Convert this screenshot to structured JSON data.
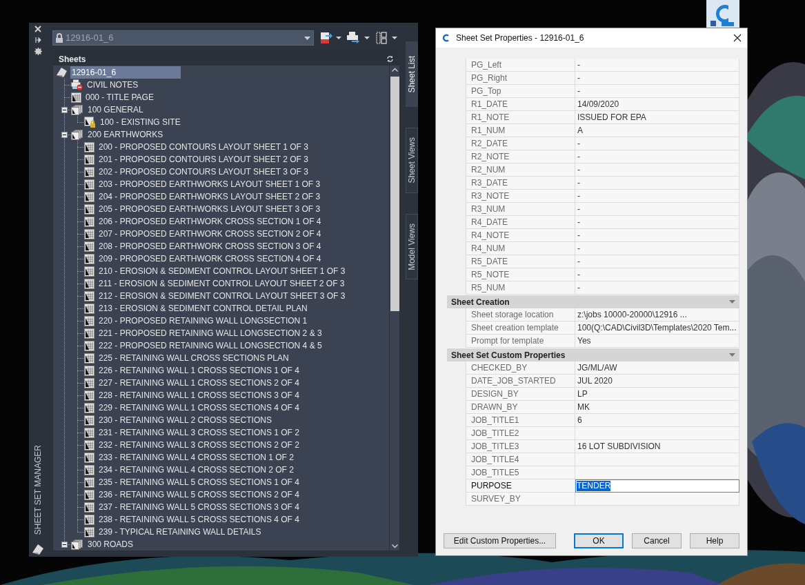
{
  "palette": {
    "title": "SHEET SET MANAGER",
    "sheet_set": "12916-01_6",
    "tabs": [
      {
        "label": "Sheet List",
        "selected": true
      },
      {
        "label": "Sheet Views",
        "selected": false
      },
      {
        "label": "Model Views",
        "selected": false
      }
    ],
    "panel_title": "Sheets",
    "tree": {
      "label": "12916-01_6",
      "kind": "sheetset",
      "selected": true,
      "children": [
        {
          "label": "CIVIL NOTES",
          "kind": "unplottable",
          "selected": false
        },
        {
          "label": "000 - TITLE PAGE",
          "kind": "sheet",
          "selected": false
        },
        {
          "label": "100 GENERAL",
          "kind": "subset",
          "expanded": true,
          "selected": false,
          "children": [
            {
              "label": "100 - EXISTING SITE",
              "kind": "locked",
              "selected": false
            }
          ]
        },
        {
          "label": "200 EARTHWORKS",
          "kind": "subset",
          "expanded": true,
          "selected": false,
          "children": [
            {
              "label": "200 - PROPOSED CONTOURS LAYOUT SHEET 1 OF 3",
              "kind": "sheet",
              "selected": false
            },
            {
              "label": "201 - PROPOSED CONTOURS LAYOUT SHEET 2 OF 3",
              "kind": "sheet",
              "selected": false
            },
            {
              "label": "202 - PROPOSED CONTOURS LAYOUT SHEET 3 OF 3",
              "kind": "sheet",
              "selected": false
            },
            {
              "label": "203 - PROPOSED EARTHWORKS LAYOUT SHEET 1 OF 3",
              "kind": "sheet",
              "selected": false
            },
            {
              "label": "204 - PROPOSED EARTHWORKS LAYOUT SHEET 2 OF 3",
              "kind": "sheet",
              "selected": false
            },
            {
              "label": "205 - PROPOSED EARTHWORKS LAYOUT SHEET 3 OF 3",
              "kind": "sheet",
              "selected": false
            },
            {
              "label": "206 - PROPOSED EARTHWORK CROSS SECTION 1 OF 4",
              "kind": "sheet",
              "selected": false
            },
            {
              "label": "207 - PROPOSED EARTHWORK CROSS SECTION 2 OF 4",
              "kind": "sheet",
              "selected": false
            },
            {
              "label": "208 - PROPOSED EARTHWORK CROSS SECTION 3 OF 4",
              "kind": "sheet",
              "selected": false
            },
            {
              "label": "209 - PROPOSED EARTHWORK CROSS SECTION 4 OF 4",
              "kind": "sheet",
              "selected": false
            },
            {
              "label": "210 - EROSION & SEDIMENT CONTROL LAYOUT SHEET 1 OF 3",
              "kind": "sheet",
              "selected": false
            },
            {
              "label": "211 - EROSION & SEDIMENT CONTROL LAYOUT SHEET 2 OF 3",
              "kind": "sheet",
              "selected": false
            },
            {
              "label": "212 - EROSION & SEDIMENT CONTROL LAYOUT SHEET 3 OF 3",
              "kind": "sheet",
              "selected": false
            },
            {
              "label": "213 - EROSION & SEDIMENT CONTROL DETAIL PLAN",
              "kind": "sheet",
              "selected": false
            },
            {
              "label": "220 - PROPOSED RETAINING WALL LONGSECTION 1",
              "kind": "sheet",
              "selected": false
            },
            {
              "label": "221 - PROPOSED RETAINING WALL LONGSECTION 2 & 3",
              "kind": "sheet",
              "selected": false
            },
            {
              "label": "222 - PROPOSED RETAINING WALL LONGSECTION 4 & 5",
              "kind": "sheet",
              "selected": false
            },
            {
              "label": "225 - RETAINING WALL CROSS SECTIONS PLAN",
              "kind": "sheet",
              "selected": false
            },
            {
              "label": "226 - RETAINING WALL 1 CROSS SECTIONS 1 OF 4",
              "kind": "sheet",
              "selected": false
            },
            {
              "label": "227 - RETAINING WALL 1 CROSS SECTIONS 2 OF 4",
              "kind": "sheet",
              "selected": false
            },
            {
              "label": "228 - RETAINING WALL 1 CROSS SECTIONS 3 OF 4",
              "kind": "sheet",
              "selected": false
            },
            {
              "label": "229 - RETAINING WALL 1 CROSS SECTIONS 4 OF 4",
              "kind": "sheet",
              "selected": false
            },
            {
              "label": "230 - RETAINING WALL 2 CROSS SECTIONS",
              "kind": "sheet",
              "selected": false
            },
            {
              "label": "231 - RETAINING WALL 3 CROSS SECTIONS 1 OF 2",
              "kind": "sheet",
              "selected": false
            },
            {
              "label": "232 - RETAINING WALL 3 CROSS SECTIONS 2 OF 2",
              "kind": "sheet",
              "selected": false
            },
            {
              "label": "233 - RETAINING WALL 4 CROSS SECTION 1 OF 2",
              "kind": "sheet",
              "selected": false
            },
            {
              "label": "234 - RETAINING WALL 4 CROSS SECTION 2 OF 2",
              "kind": "sheet",
              "selected": false
            },
            {
              "label": "235 - RETAINING WALL 5 CROSS SECTIONS 1 OF 4",
              "kind": "sheet",
              "selected": false
            },
            {
              "label": "236 - RETAINING WALL 5 CROSS SECTIONS 2 OF 4",
              "kind": "sheet",
              "selected": false
            },
            {
              "label": "237 - RETAINING WALL 5 CROSS SECTIONS 3 OF 4",
              "kind": "sheet",
              "selected": false
            },
            {
              "label": "238 - RETAINING WALL 5 CROSS SECTIONS 4 OF 4",
              "kind": "sheet",
              "selected": false
            },
            {
              "label": "239 - TYPICAL RETAINING WALL DETAILS",
              "kind": "sheet",
              "selected": false
            }
          ]
        },
        {
          "label": "300 ROADS",
          "kind": "subset",
          "expanded": true,
          "selected": false
        }
      ]
    }
  },
  "dialog": {
    "title": "Sheet Set Properties - 12916-01_6",
    "sections": [
      {
        "rows": [
          {
            "name": "PG_Left",
            "value": "-"
          },
          {
            "name": "PG_Right",
            "value": "-"
          },
          {
            "name": "PG_Top",
            "value": "-"
          },
          {
            "name": "R1_DATE",
            "value": "14/09/2020"
          },
          {
            "name": "R1_NOTE",
            "value": "ISSUED FOR EPA"
          },
          {
            "name": "R1_NUM",
            "value": "A"
          },
          {
            "name": "R2_DATE",
            "value": "-"
          },
          {
            "name": "R2_NOTE",
            "value": "-"
          },
          {
            "name": "R2_NUM",
            "value": "-"
          },
          {
            "name": "R3_DATE",
            "value": "-"
          },
          {
            "name": "R3_NOTE",
            "value": "-"
          },
          {
            "name": "R3_NUM",
            "value": "-"
          },
          {
            "name": "R4_DATE",
            "value": "-"
          },
          {
            "name": "R4_NOTE",
            "value": "-"
          },
          {
            "name": "R4_NUM",
            "value": "-"
          },
          {
            "name": "R5_DATE",
            "value": "-"
          },
          {
            "name": "R5_NOTE",
            "value": "-"
          },
          {
            "name": "R5_NUM",
            "value": "-"
          }
        ]
      },
      {
        "title": "Sheet Creation",
        "rows": [
          {
            "name": "Sheet storage location",
            "value": "z:\\jobs 10000-20000\\12916 ..."
          },
          {
            "name": "Sheet creation template",
            "value": "100(Q:\\CAD\\Civil3D\\Templates\\2020  Tem..."
          },
          {
            "name": "Prompt for template",
            "value": "Yes"
          }
        ]
      },
      {
        "title": "Sheet Set Custom Properties",
        "rows": [
          {
            "name": "CHECKED_BY",
            "value": "JG/ML/AW"
          },
          {
            "name": "DATE_JOB_STARTED",
            "value": "JUL 2020"
          },
          {
            "name": "DESIGN_BY",
            "value": "LP"
          },
          {
            "name": "DRAWN_BY",
            "value": "MK"
          },
          {
            "name": "JOB_TITLE1",
            "value": "6"
          },
          {
            "name": "JOB_TITLE2"
          },
          {
            "name": "JOB_TITLE3",
            "value": "16 LOT SUBDIVISION"
          },
          {
            "name": "JOB_TITLE4"
          },
          {
            "name": "JOB_TITLE5"
          },
          {
            "name": "PURPOSE",
            "value": "TENDER",
            "editing": true
          },
          {
            "name": "SURVEY_BY"
          }
        ]
      }
    ],
    "buttons": [
      {
        "label": "Edit Custom Properties...",
        "focused": false
      },
      {
        "label": "OK",
        "focused": true
      },
      {
        "label": "Cancel",
        "focused": false
      },
      {
        "label": "Help",
        "focused": false
      }
    ]
  }
}
